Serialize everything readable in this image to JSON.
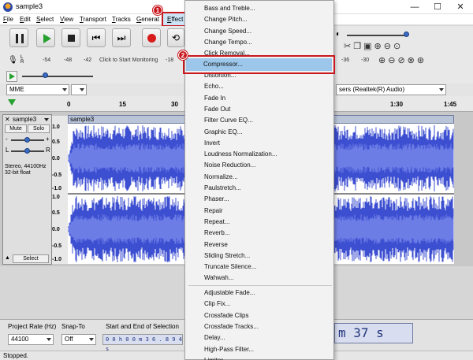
{
  "window": {
    "title": "sample3",
    "minimize": "—",
    "maximize": "☐",
    "close": "✕"
  },
  "menubar": {
    "items": [
      "File",
      "Edit",
      "Select",
      "View",
      "Transport",
      "Tracks",
      "Generat",
      "Effect"
    ]
  },
  "annotations": {
    "step1": "1",
    "step2": "2"
  },
  "meter": {
    "record_scale": [
      "-54",
      "-48",
      "-42",
      "Click to Start Monitoring",
      "-18"
    ],
    "right_scale": [
      "-36",
      "-30"
    ],
    "channel_l": "L",
    "channel_r": "R"
  },
  "device": {
    "host": "MME",
    "output": "sers (Realtek(R) Audio)"
  },
  "timeline": {
    "ticks_left": [
      "0",
      "15",
      "30"
    ],
    "ticks_right": [
      "1:30",
      "1:45"
    ]
  },
  "track": {
    "name": "sample3",
    "mute": "Mute",
    "solo": "Solo",
    "minus": "-",
    "plus": "+",
    "left": "L",
    "right": "R",
    "info_rate": "Stereo, 44100Hz",
    "info_format": "32-bit float",
    "select": "Select",
    "collapse": "▲",
    "clip_title": "sample3",
    "amp_labels": [
      "1.0",
      "0.5",
      "0.0",
      "-0.5",
      "-1.0",
      "1.0",
      "0.5",
      "0.0",
      "-0.5",
      "-1.0"
    ]
  },
  "effect_menu": {
    "items_group1": [
      "Bass and Treble...",
      "Change Pitch...",
      "Change Speed...",
      "Change Tempo...",
      "Click Removal..."
    ],
    "active_item": "Compressor...",
    "items_group2": [
      "Distortion...",
      "Echo...",
      "Fade In",
      "Fade Out",
      "Filter Curve EQ...",
      "Graphic EQ...",
      "Invert",
      "Loudness Normalization...",
      "Noise Reduction...",
      "Normalize...",
      "Paulstretch...",
      "Phaser...",
      "Repair",
      "Repeat...",
      "Reverb...",
      "Reverse",
      "Sliding Stretch...",
      "Truncate Silence...",
      "Wahwah..."
    ],
    "items_group3": [
      "Adjustable Fade...",
      "Clip Fix...",
      "Crossfade Clips",
      "Crossfade Tracks...",
      "Delay...",
      "High-Pass Filter...",
      "Limiter..."
    ]
  },
  "bottom": {
    "project_rate_label": "Project Rate (Hz)",
    "project_rate_value": "44100",
    "snap_label": "Snap-To",
    "snap_value": "Off",
    "selection_label": "Start and End of Selection",
    "selection_value": "0 0 h 0 0 m 3 6 . 8 9 4 s",
    "time_display": "m 37 s"
  },
  "status": {
    "text": "Stopped."
  },
  "colors": {
    "accent_red": "#c8181e",
    "waveform_blue": "#3d4fd1",
    "menu_highlight": "#9cc7ea"
  }
}
